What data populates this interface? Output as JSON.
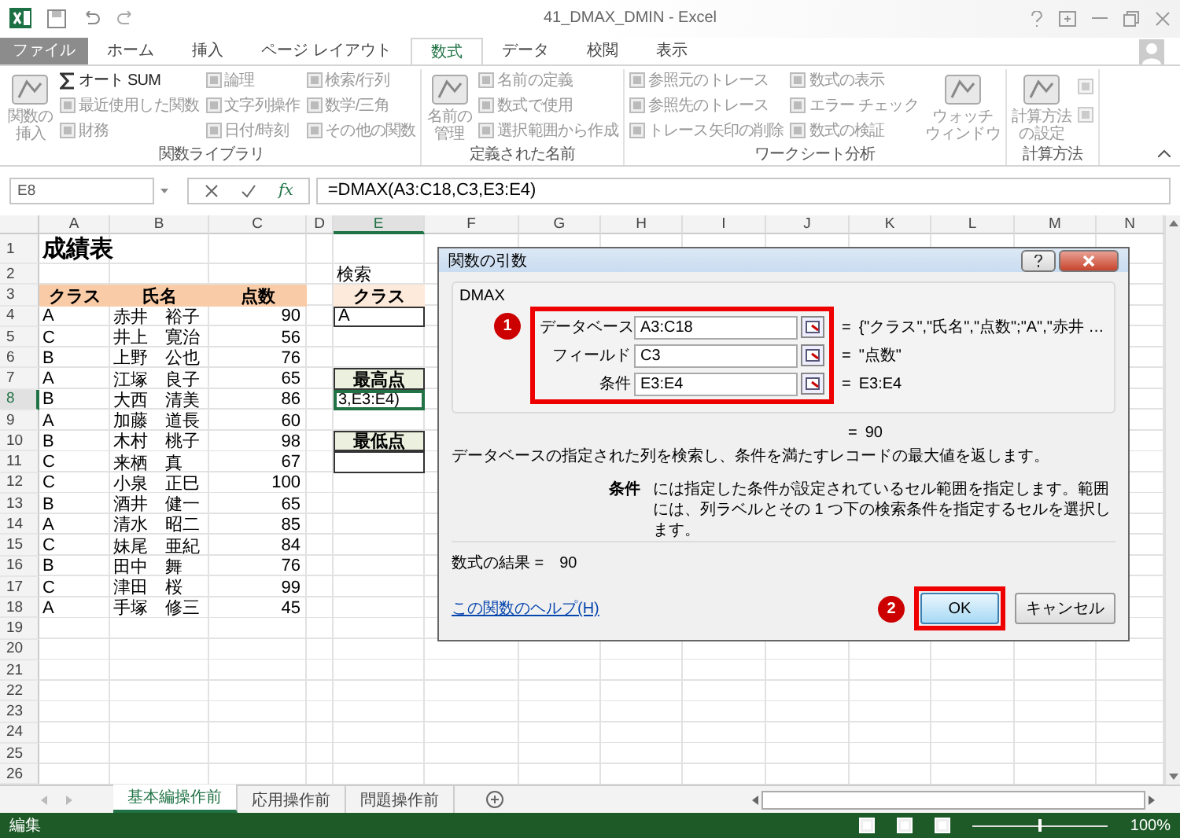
{
  "window": {
    "title": "41_DMAX_DMIN - Excel"
  },
  "ribbon": {
    "tabs": [
      {
        "label": "ファイル",
        "kind": "file",
        "selected": false
      },
      {
        "label": "ホーム",
        "kind": "tab",
        "selected": false
      },
      {
        "label": "挿入",
        "kind": "tab",
        "selected": false
      },
      {
        "label": "ページ レイアウト",
        "kind": "tab",
        "selected": false
      },
      {
        "label": "数式",
        "kind": "tab",
        "selected": true
      },
      {
        "label": "データ",
        "kind": "tab",
        "selected": false
      },
      {
        "label": "校閲",
        "kind": "tab",
        "selected": false
      },
      {
        "label": "表示",
        "kind": "tab",
        "selected": false
      }
    ],
    "groups": [
      {
        "label": "関数ライブラリ",
        "items": [
          {
            "kind": "large",
            "lines": [
              "関数の",
              "挿入"
            ],
            "disabled": true
          },
          {
            "kind": "column",
            "entries": [
              {
                "label": "オート SUM",
                "disabled": false,
                "kind": "sigma"
              },
              {
                "label": "最近使用した関数",
                "disabled": true,
                "kind": "plain"
              },
              {
                "label": "財務",
                "disabled": true,
                "kind": "plain"
              }
            ]
          },
          {
            "kind": "column",
            "entries": [
              {
                "label": "論理",
                "disabled": true,
                "kind": "plain"
              },
              {
                "label": "文字列操作",
                "disabled": true,
                "kind": "plain"
              },
              {
                "label": "日付/時刻",
                "disabled": true,
                "kind": "plain"
              }
            ]
          },
          {
            "kind": "column",
            "entries": [
              {
                "label": "検索/行列",
                "disabled": true,
                "kind": "plain"
              },
              {
                "label": "数学/三角",
                "disabled": true,
                "kind": "plain"
              },
              {
                "label": "その他の関数",
                "disabled": true,
                "kind": "plain"
              }
            ]
          }
        ]
      },
      {
        "label": "定義された名前",
        "items": [
          {
            "kind": "large",
            "lines": [
              "名前の",
              "管理"
            ],
            "disabled": true
          },
          {
            "kind": "column",
            "entries": [
              {
                "label": "名前の定義",
                "disabled": true,
                "kind": "plain"
              },
              {
                "label": "数式で使用",
                "disabled": true,
                "kind": "plain"
              },
              {
                "label": "選択範囲から作成",
                "disabled": true,
                "kind": "plain"
              }
            ]
          }
        ]
      },
      {
        "label": "ワークシート分析",
        "items": [
          {
            "kind": "column",
            "entries": [
              {
                "label": "参照元のトレース",
                "disabled": true,
                "kind": "plain"
              },
              {
                "label": "参照先のトレース",
                "disabled": true,
                "kind": "plain"
              },
              {
                "label": "トレース矢印の削除",
                "disabled": true,
                "kind": "plain"
              }
            ]
          },
          {
            "kind": "column",
            "entries": [
              {
                "label": "数式の表示",
                "disabled": true,
                "kind": "plain"
              },
              {
                "label": "エラー チェック",
                "disabled": true,
                "kind": "plain"
              },
              {
                "label": "数式の検証",
                "disabled": true,
                "kind": "plain"
              }
            ]
          },
          {
            "kind": "large",
            "lines": [
              "ウォッチ",
              "ウィンドウ"
            ],
            "disabled": true
          }
        ]
      },
      {
        "label": "計算方法",
        "items": [
          {
            "kind": "large",
            "lines": [
              "計算方法",
              "の設定"
            ],
            "disabled": true
          },
          {
            "kind": "icons",
            "disabled": true
          }
        ]
      }
    ]
  },
  "formula_bar": {
    "name_box": "E8",
    "fx": "fx",
    "formula": "=DMAX(A3:C18,C3,E3:E4)"
  },
  "sheet": {
    "columns": [
      {
        "label": "A",
        "selected": false
      },
      {
        "label": "B",
        "selected": false
      },
      {
        "label": "C",
        "selected": false
      },
      {
        "label": "D",
        "selected": false
      },
      {
        "label": "E",
        "selected": true
      },
      {
        "label": "F",
        "selected": false
      },
      {
        "label": "G",
        "selected": false
      },
      {
        "label": "H",
        "selected": false
      },
      {
        "label": "I",
        "selected": false
      },
      {
        "label": "J",
        "selected": false
      },
      {
        "label": "K",
        "selected": false
      },
      {
        "label": "L",
        "selected": false
      },
      {
        "label": "M",
        "selected": false
      },
      {
        "label": "N",
        "selected": false
      }
    ],
    "rows": [
      {
        "number": "1",
        "selected": false,
        "cells": [
          {
            "kind": "title",
            "text": "成績表"
          }
        ]
      },
      {
        "number": "2",
        "selected": false,
        "cells": [
          {
            "kind": "blank"
          },
          {
            "kind": "blank"
          },
          {
            "kind": "blank"
          },
          {
            "kind": "blank"
          },
          {
            "kind": "text",
            "text": "検索"
          }
        ]
      },
      {
        "number": "3",
        "selected": false,
        "cells": [
          {
            "kind": "header",
            "text": "クラス"
          },
          {
            "kind": "header",
            "text": "氏名"
          },
          {
            "kind": "header",
            "text": "点数"
          },
          {
            "kind": "blank"
          },
          {
            "kind": "criteria",
            "text": "クラス"
          }
        ]
      },
      {
        "number": "4",
        "selected": false,
        "cells": [
          {
            "kind": "text",
            "text": "A"
          },
          {
            "kind": "text",
            "text": "赤井　裕子"
          },
          {
            "kind": "number",
            "text": "90"
          },
          {
            "kind": "blank"
          },
          {
            "kind": "input",
            "text": "A"
          }
        ]
      },
      {
        "number": "5",
        "selected": false,
        "cells": [
          {
            "kind": "text",
            "text": "C"
          },
          {
            "kind": "text",
            "text": "井上　寛治"
          },
          {
            "kind": "number",
            "text": "56"
          }
        ]
      },
      {
        "number": "6",
        "selected": false,
        "cells": [
          {
            "kind": "text",
            "text": "B"
          },
          {
            "kind": "text",
            "text": "上野　公也"
          },
          {
            "kind": "number",
            "text": "76"
          }
        ]
      },
      {
        "number": "7",
        "selected": false,
        "cells": [
          {
            "kind": "text",
            "text": "A"
          },
          {
            "kind": "text",
            "text": "江塚　良子"
          },
          {
            "kind": "number",
            "text": "65"
          },
          {
            "kind": "blank"
          },
          {
            "kind": "label",
            "text": "最高点"
          }
        ]
      },
      {
        "number": "8",
        "selected": true,
        "cells": [
          {
            "kind": "text",
            "text": "B"
          },
          {
            "kind": "text",
            "text": "大西　清美"
          },
          {
            "kind": "number",
            "text": "86"
          },
          {
            "kind": "blank"
          },
          {
            "kind": "active",
            "text": "3,E3:E4)"
          }
        ]
      },
      {
        "number": "9",
        "selected": false,
        "cells": [
          {
            "kind": "text",
            "text": "A"
          },
          {
            "kind": "text",
            "text": "加藤　道長"
          },
          {
            "kind": "number",
            "text": "60"
          }
        ]
      },
      {
        "number": "10",
        "selected": false,
        "cells": [
          {
            "kind": "text",
            "text": "B"
          },
          {
            "kind": "text",
            "text": "木村　桃子"
          },
          {
            "kind": "number",
            "text": "98"
          },
          {
            "kind": "blank"
          },
          {
            "kind": "label",
            "text": "最低点"
          }
        ]
      },
      {
        "number": "11",
        "selected": false,
        "cells": [
          {
            "kind": "text",
            "text": "C"
          },
          {
            "kind": "text",
            "text": "来栖　真"
          },
          {
            "kind": "number",
            "text": "67"
          },
          {
            "kind": "blank"
          },
          {
            "kind": "input"
          }
        ]
      },
      {
        "number": "12",
        "selected": false,
        "cells": [
          {
            "kind": "text",
            "text": "C"
          },
          {
            "kind": "text",
            "text": "小泉　正巳"
          },
          {
            "kind": "number",
            "text": "100"
          }
        ]
      },
      {
        "number": "13",
        "selected": false,
        "cells": [
          {
            "kind": "text",
            "text": "B"
          },
          {
            "kind": "text",
            "text": "酒井　健一"
          },
          {
            "kind": "number",
            "text": "65"
          }
        ]
      },
      {
        "number": "14",
        "selected": false,
        "cells": [
          {
            "kind": "text",
            "text": "A"
          },
          {
            "kind": "text",
            "text": "清水　昭二"
          },
          {
            "kind": "number",
            "text": "85"
          }
        ]
      },
      {
        "number": "15",
        "selected": false,
        "cells": [
          {
            "kind": "text",
            "text": "C"
          },
          {
            "kind": "text",
            "text": "妹尾　亜紀"
          },
          {
            "kind": "number",
            "text": "84"
          }
        ]
      },
      {
        "number": "16",
        "selected": false,
        "cells": [
          {
            "kind": "text",
            "text": "B"
          },
          {
            "kind": "text",
            "text": "田中　舞"
          },
          {
            "kind": "number",
            "text": "76"
          }
        ]
      },
      {
        "number": "17",
        "selected": false,
        "cells": [
          {
            "kind": "text",
            "text": "C"
          },
          {
            "kind": "text",
            "text": "津田　桜"
          },
          {
            "kind": "number",
            "text": "99"
          }
        ]
      },
      {
        "number": "18",
        "selected": false,
        "cells": [
          {
            "kind": "text",
            "text": "A"
          },
          {
            "kind": "text",
            "text": "手塚　修三"
          },
          {
            "kind": "number",
            "text": "45"
          }
        ]
      },
      {
        "number": "19",
        "selected": false,
        "cells": []
      },
      {
        "number": "20",
        "selected": false,
        "cells": []
      },
      {
        "number": "21",
        "selected": false,
        "cells": []
      },
      {
        "number": "22",
        "selected": false,
        "cells": []
      },
      {
        "number": "23",
        "selected": false,
        "cells": []
      },
      {
        "number": "24",
        "selected": false,
        "cells": []
      },
      {
        "number": "25",
        "selected": false,
        "cells": []
      },
      {
        "number": "26",
        "selected": false,
        "cells": []
      }
    ]
  },
  "dialog": {
    "title": "関数の引数",
    "function": "DMAX",
    "marker": "1",
    "arguments": [
      {
        "label": "データベース",
        "value": "A3:C18",
        "sign": "=",
        "result": "{\"クラス\",\"氏名\",\"点数\";\"A\",\"赤井 …"
      },
      {
        "label": "フィールド",
        "value": "C3",
        "sign": "=",
        "result": "\"点数\""
      },
      {
        "label": "条件",
        "value": "E3:E4",
        "sign": "=",
        "result": "E3:E4"
      }
    ],
    "result_sign": "=",
    "result": "90",
    "description": "データベースの指定された列を検索し、条件を満たすレコードの最大値を返します。",
    "argument_name": "条件",
    "argument_help": "には指定した条件が設定されているセル範囲を指定します。範囲には、列ラベルとその 1 つ下の検索条件を指定するセルを選択します。",
    "formula_result": "数式の結果 =　90",
    "help_link": "この関数のヘルプ(H)",
    "buttons": [
      {
        "label": "OK",
        "kind": "primary",
        "marker": "2"
      },
      {
        "label": "キャンセル",
        "kind": "secondary"
      }
    ]
  },
  "sheet_tabs": [
    {
      "label": "基本編操作前",
      "selected": true
    },
    {
      "label": "応用操作前",
      "selected": false
    },
    {
      "label": "問題操作前",
      "selected": false
    }
  ],
  "status_bar": {
    "mode": "編集",
    "zoom_slider": {
      "level": 0.5
    },
    "zoom": "100%"
  }
}
